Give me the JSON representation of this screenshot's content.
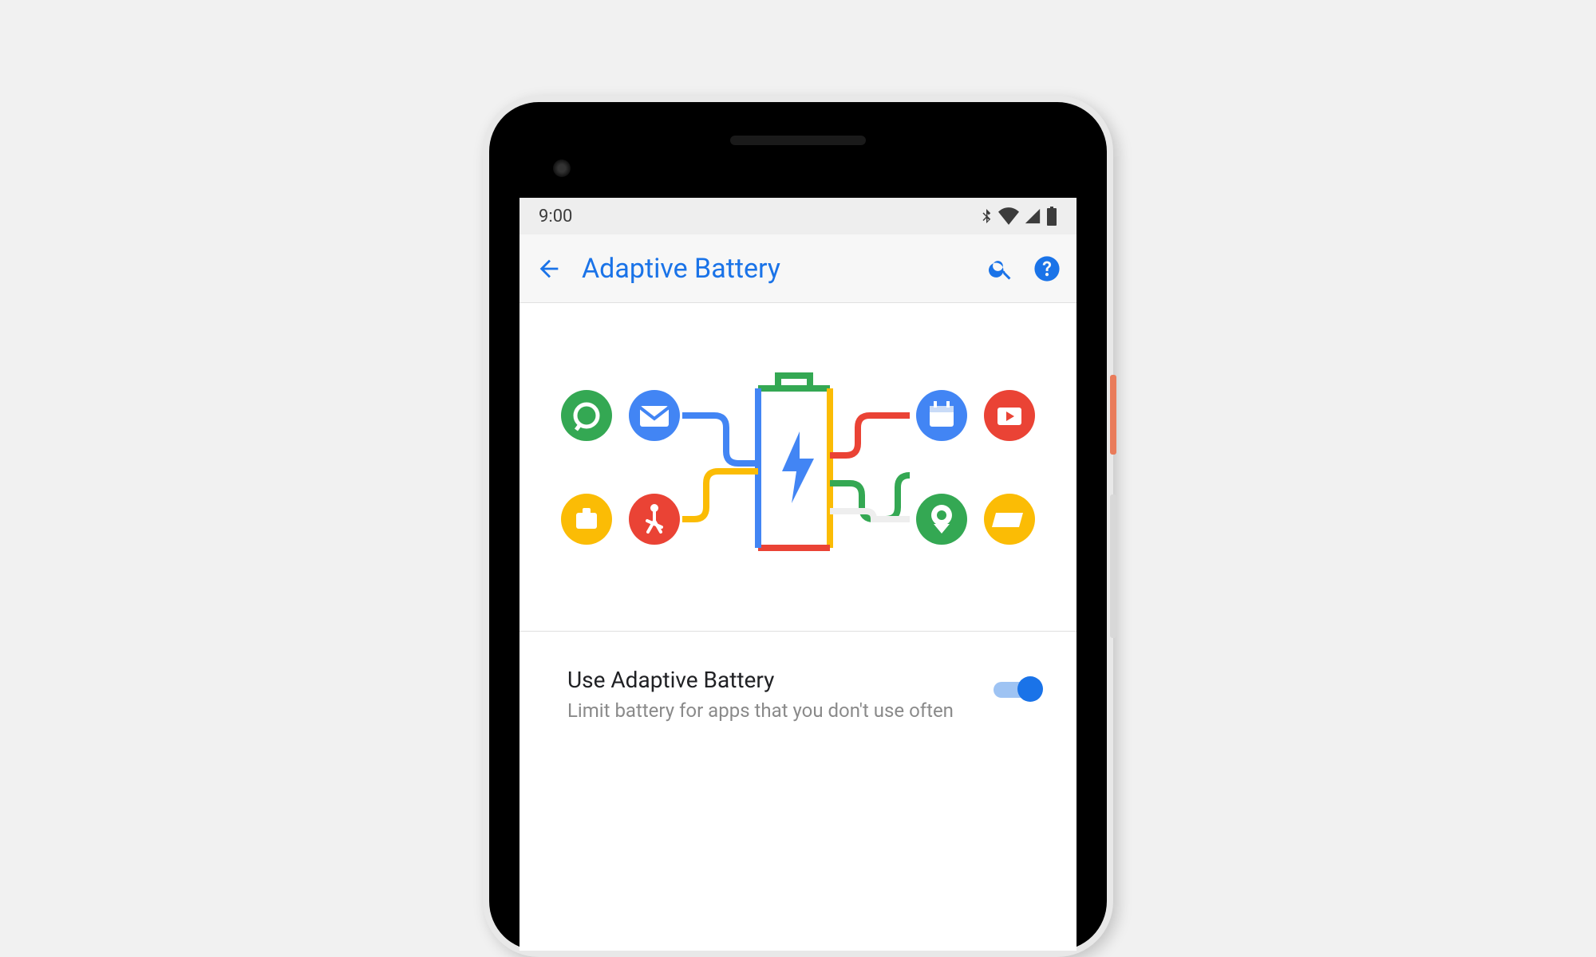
{
  "status_bar": {
    "time": "9:00"
  },
  "app_bar": {
    "title": "Adaptive Battery"
  },
  "setting": {
    "title": "Use Adaptive Battery",
    "subtitle": "Limit battery for apps that you don't use often",
    "enabled": true
  },
  "colors": {
    "accent": "#1a73e8",
    "google_blue": "#4285F4",
    "google_red": "#EA4335",
    "google_yellow": "#FBBC05",
    "google_green": "#34A853"
  }
}
